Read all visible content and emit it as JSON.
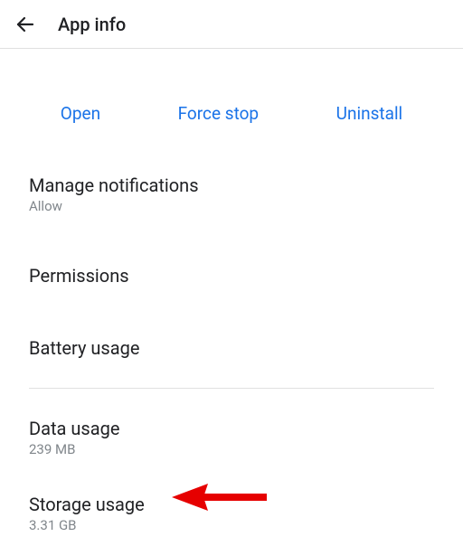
{
  "header": {
    "title": "App info"
  },
  "actions": {
    "open": "Open",
    "force_stop": "Force stop",
    "uninstall": "Uninstall"
  },
  "items": {
    "notifications": {
      "title": "Manage notifications",
      "sub": "Allow"
    },
    "permissions": {
      "title": "Permissions"
    },
    "battery": {
      "title": "Battery usage"
    },
    "data": {
      "title": "Data usage",
      "sub": "239 MB"
    },
    "storage": {
      "title": "Storage usage",
      "sub": "3.31 GB"
    }
  },
  "colors": {
    "accent": "#1a73e8",
    "annotation": "#e60000"
  }
}
